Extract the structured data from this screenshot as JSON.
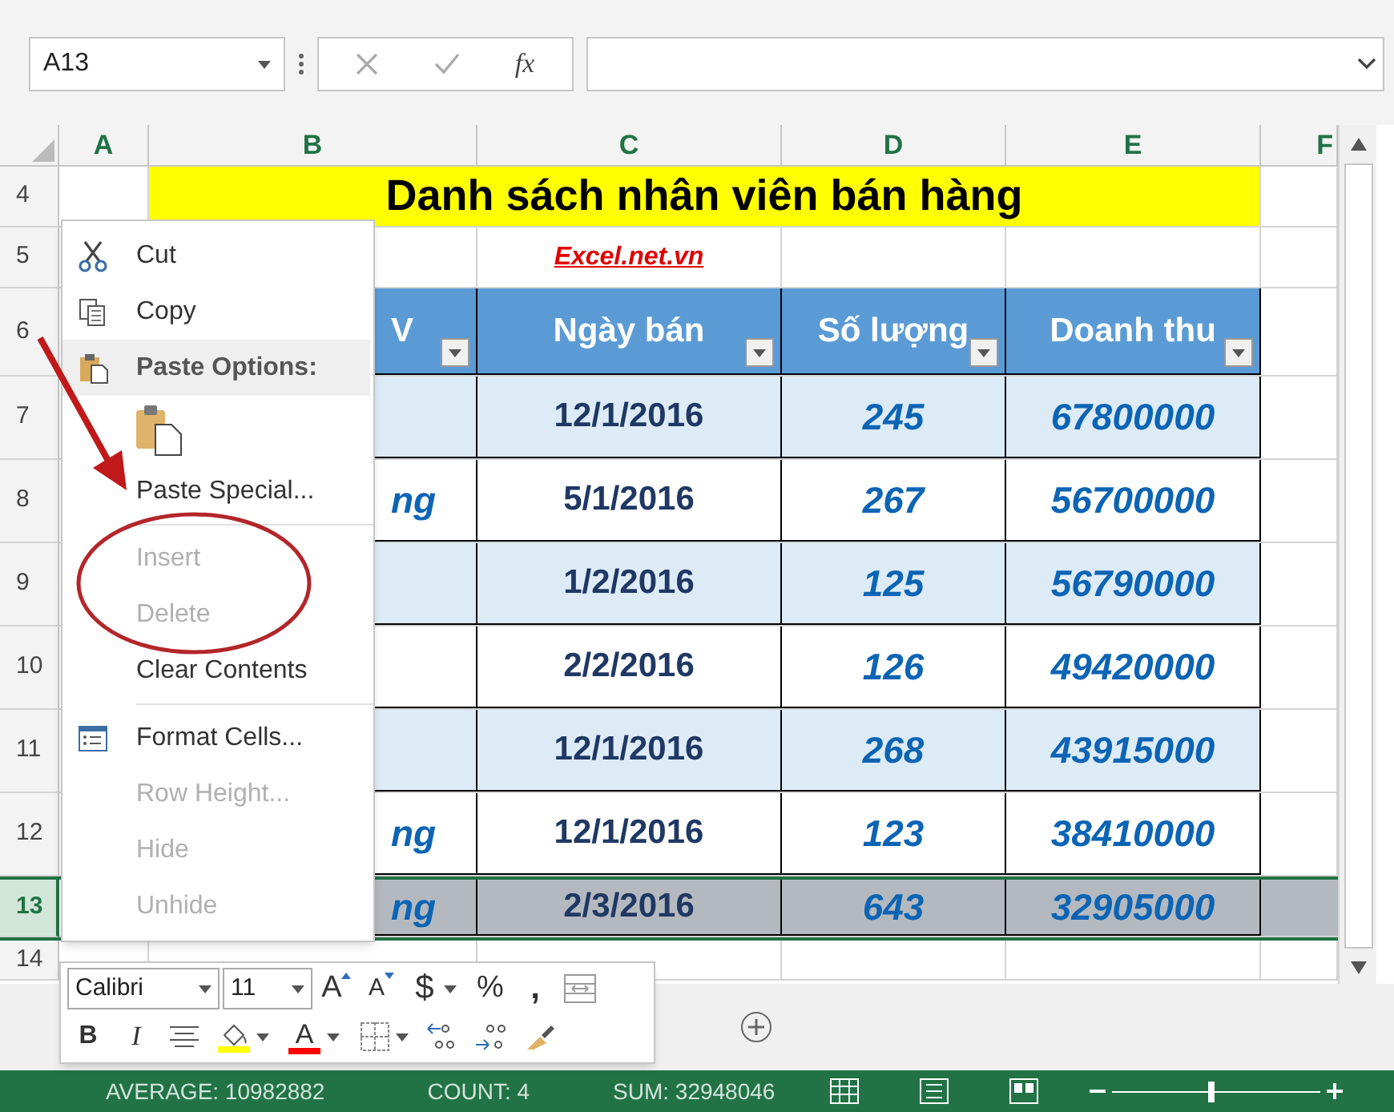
{
  "formula_bar": {
    "name_box": "A13",
    "function_label": "fx"
  },
  "columns": [
    "A",
    "B",
    "C",
    "D",
    "E",
    "F"
  ],
  "rows": [
    {
      "number": "4",
      "selected": false,
      "kind": "title",
      "text": "Danh sách nhân viên bán hàng"
    },
    {
      "number": "5",
      "selected": false,
      "kind": "link",
      "text": "Excel.net.vn"
    },
    {
      "number": "6",
      "selected": false,
      "kind": "header",
      "cells": [
        "V",
        "Ngày bán",
        "Số lượng",
        "Doanh thu"
      ]
    },
    {
      "number": "7",
      "selected": false,
      "kind": "data",
      "cells": [
        null,
        "12/1/2016",
        "245",
        "67800000"
      ]
    },
    {
      "number": "8",
      "selected": false,
      "kind": "data",
      "cells": [
        "ng",
        "5/1/2016",
        "267",
        "56700000"
      ]
    },
    {
      "number": "9",
      "selected": false,
      "kind": "data",
      "cells": [
        null,
        "1/2/2016",
        "125",
        "56790000"
      ]
    },
    {
      "number": "10",
      "selected": false,
      "kind": "data",
      "cells": [
        null,
        "2/2/2016",
        "126",
        "49420000"
      ]
    },
    {
      "number": "11",
      "selected": false,
      "kind": "data",
      "cells": [
        null,
        "12/1/2016",
        "268",
        "43915000"
      ]
    },
    {
      "number": "12",
      "selected": false,
      "kind": "data",
      "cells": [
        "ng",
        "12/1/2016",
        "123",
        "38410000"
      ]
    },
    {
      "number": "13",
      "selected": true,
      "kind": "data",
      "cells": [
        "ng",
        "2/3/2016",
        "643",
        "32905000"
      ]
    },
    {
      "number": "14",
      "selected": false,
      "kind": "empty"
    }
  ],
  "context_menu": [
    {
      "kind": "cut",
      "label": "Cut",
      "disabled": false
    },
    {
      "kind": "copy",
      "label": "Copy",
      "disabled": false
    },
    {
      "kind": "section",
      "label": "Paste Options:"
    },
    {
      "kind": "paste",
      "disabled": false
    },
    {
      "kind": "command",
      "label": "Paste Special...",
      "disabled": false
    },
    {
      "kind": "separator"
    },
    {
      "kind": "command",
      "label": "Insert",
      "disabled": true
    },
    {
      "kind": "command",
      "label": "Delete",
      "disabled": true
    },
    {
      "kind": "command",
      "label": "Clear Contents",
      "disabled": false
    },
    {
      "kind": "separator"
    },
    {
      "kind": "format",
      "label": "Format Cells...",
      "disabled": false
    },
    {
      "kind": "command",
      "label": "Row Height...",
      "disabled": true
    },
    {
      "kind": "command",
      "label": "Hide",
      "disabled": true
    },
    {
      "kind": "command",
      "label": "Unhide",
      "disabled": true
    }
  ],
  "mini_toolbar": {
    "font": "Calibri",
    "size": "11",
    "grow_font": "A",
    "shrink_font": "A",
    "currency": "$",
    "percent": "%",
    "comma": ",",
    "bold": "B",
    "italic": "I",
    "font_color": "A"
  },
  "zoom": {
    "level": 0.48
  },
  "status_bar": [
    "AVERAGE: 10982882",
    "COUNT: 4",
    "SUM: 32948046"
  ]
}
